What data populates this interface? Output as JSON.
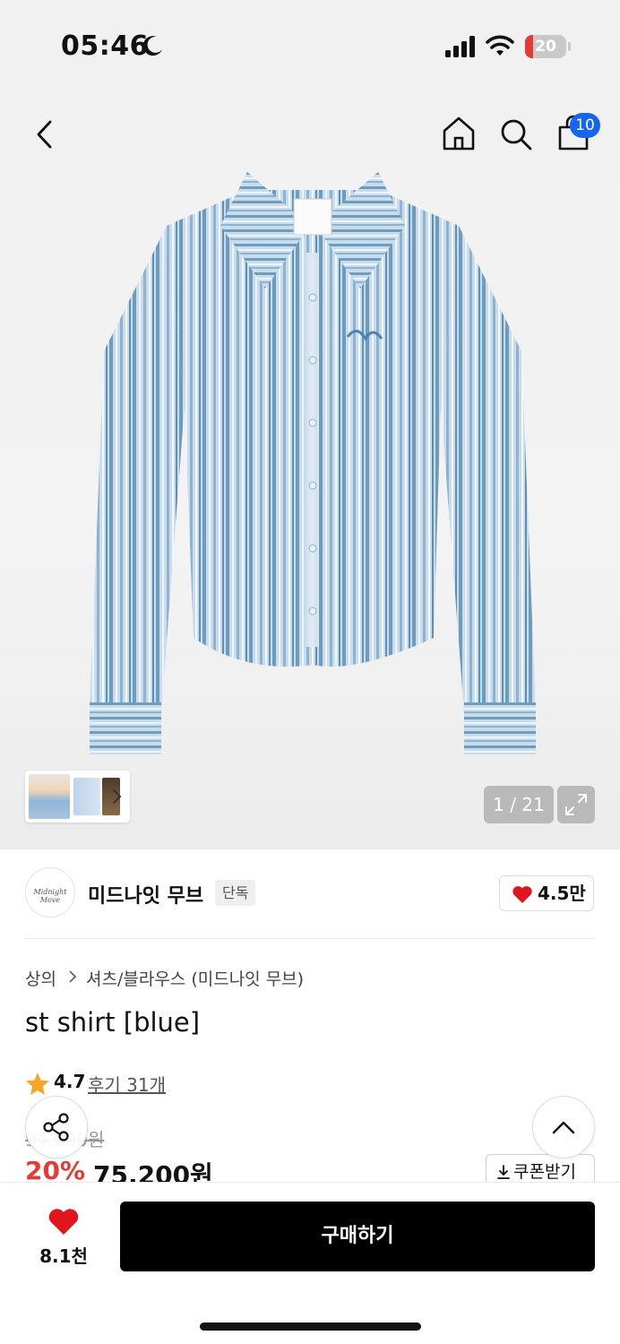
{
  "status_bar": {
    "time": "05:46",
    "battery": "20",
    "battery_fraction": 0.2,
    "icons": [
      "moon-icon",
      "cellular-signal-icon",
      "wifi-icon",
      "battery-icon"
    ]
  },
  "header": {
    "icons": [
      "back-arrow-icon",
      "home-icon",
      "search-icon",
      "shopping-bag-icon"
    ],
    "cart_badge": "10"
  },
  "gallery": {
    "page_indicator": "1 / 21",
    "icons": [
      "chevron-right-icon",
      "expand-icon"
    ]
  },
  "brand": {
    "logo_text": "Midnight Move",
    "name": "미드나잇 무브",
    "tag": "단독",
    "like_count": "4.5만"
  },
  "breadcrumb": {
    "category": "상의",
    "subcategory": "셔츠/블라우스 (미드나잇 무브)"
  },
  "product": {
    "title": "st shirt [blue]",
    "rating": "4.7",
    "reviews": "후기 31개",
    "original_price": "94,000원",
    "discount": "20%",
    "sale_price": "75,200원",
    "coupon_label": "쿠폰받기"
  },
  "bottom_bar": {
    "wish_count": "8.1천",
    "buy_label": "구매하기"
  },
  "colors": {
    "accent_blue": "#1565f0",
    "discount_red": "#e53935",
    "heart_red": "#e0151d",
    "star_orange": "#f5a623",
    "buy_button": "#000000"
  }
}
